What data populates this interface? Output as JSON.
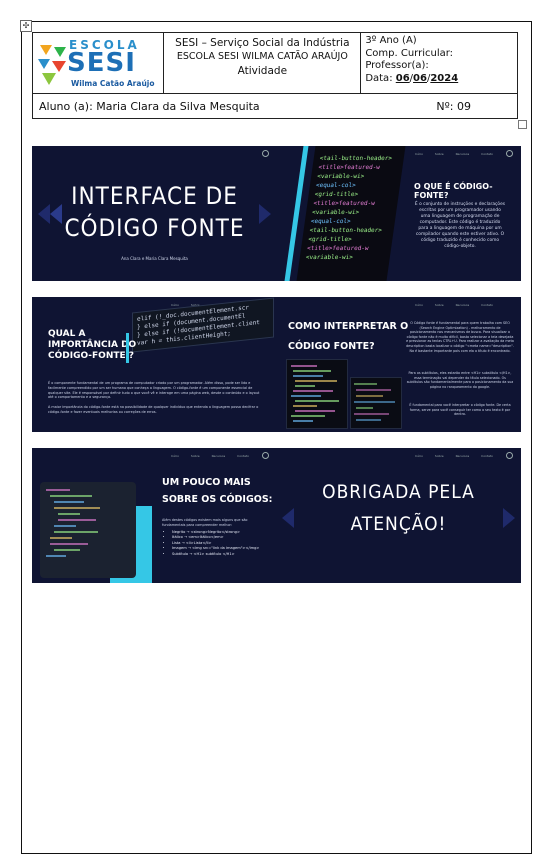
{
  "header": {
    "logo_escola": "ESCOLA",
    "logo_sesi": "SESI",
    "logo_sub": "Wilma Catão Araújo",
    "org": "SESI – Serviço Social da Indústria",
    "school": "ESCOLA SESI WILMA CATÃO ARAÚJO",
    "activity": "Atividade",
    "year": "3º Ano (A)",
    "comp": "Comp. Curricular:",
    "prof": "Professor(a):",
    "date_label": "Data:",
    "date_day": "06",
    "date_month": "06",
    "date_year": "2024",
    "student": "Aluno (a): Maria Clara da Silva Mesquita",
    "number": "Nº: 09"
  },
  "slides": {
    "s1": {
      "title_l1": "INTERFACE DE",
      "title_l2": "CÓDIGO FONTE",
      "authors": "Ana Clara e Maria Clara Mesquita"
    },
    "s2": {
      "title": "O QUE É CÓDIGO-FONTE?",
      "body": "É o conjunto de instruções e declarações escritas por um programador usando uma linguagem de programação de computador. Este código é traduzido para a linguagem de máquina por um compilador quando este estiver ativo. O código traduzido é conhecido como código-objeto."
    },
    "s3": {
      "title_l1": "QUAL A",
      "title_l2": "IMPORTÂNCIA DO",
      "title_l3": "CÓDIGO-FONTE ?",
      "p1": "É o componente fundamental de um programa de computador criado por um programador. Além disso, pode ser lido e facilmente compreendido por um ser humano que conheça a linguagem. O código-fonte é um componente essencial de qualquer site. Ele é responsável por definir tudo o que você vê e interage em uma página web, desde o conteúdo e o layout até o comportamento e a segurança.",
      "p2": "A maior importância do código-fonte está na possibilidade de qualquer indivíduo que entenda a linguagem possa decifrar o código-fonte e fazer eventuais melhorias ou correções de erros."
    },
    "s4": {
      "title_l1": "COMO INTERPRETAR O",
      "title_l2": "CÓDIGO FONTE?",
      "p1": "O Código fonte é fundamental para quem trabalha com SEO (Search Engine Optimization) - melhoramento de posicionamento nos mecanismos de busca. Para visualizar o código fonte não é muito difícil, basta selecionar a tela desejada e pressionar as teclas CTRL+U. Para realizar a avaliação da meta description basta localizar o código \"<meta name=\"description\". Na é bastante importante pois com ela o título é encontrado.",
      "p2": "Para os subtítulos, eles estarão entre <H1> substitulo </H1>, essa terminação vai depender do título selecionado. Os subtítulos são fundamentalmente para o posicionamento da sua página no ranqueamento do google.",
      "p3": "É fundamental para você interpretar o código fonte. De certa forma, serve para você conseguir ter como o seu texto é por dentro."
    },
    "s5": {
      "title_l1": "UM POUCO MAIS",
      "title_l2": "SOBRE OS CÓDIGOS:",
      "intro": "Além destes códigos existem mais alguns que são fundamentais para compreender melhor:",
      "items": [
        "Negrito → <strong>Negrito</strong>",
        "Itálico → <em>Itálico</em>",
        "Lista → <li>Lista</li>",
        "Imagem → <img src=\"link da imagem\"></img>",
        "Subtítulo → <H1> subtítulo </H1>"
      ]
    },
    "s6": {
      "title_l1": "OBRIGADA PELA",
      "title_l2": "ATENÇÃO!"
    }
  },
  "nav": [
    "Início",
    "Sobre",
    "Recursos",
    "Contato"
  ],
  "code_lines": [
    "elif (!_doc.documentElement.scr",
    "} else if (document.documentEl",
    "} else if (!documentElement.client",
    "var h = this.clientHeight;",
    "<tail-button-header>",
    "<title>featured-w",
    "<variable-wi>",
    "<equal-col>",
    "<grid-title>"
  ],
  "colors": {
    "bg": "#0f1433",
    "accent": "#35c7e6"
  }
}
